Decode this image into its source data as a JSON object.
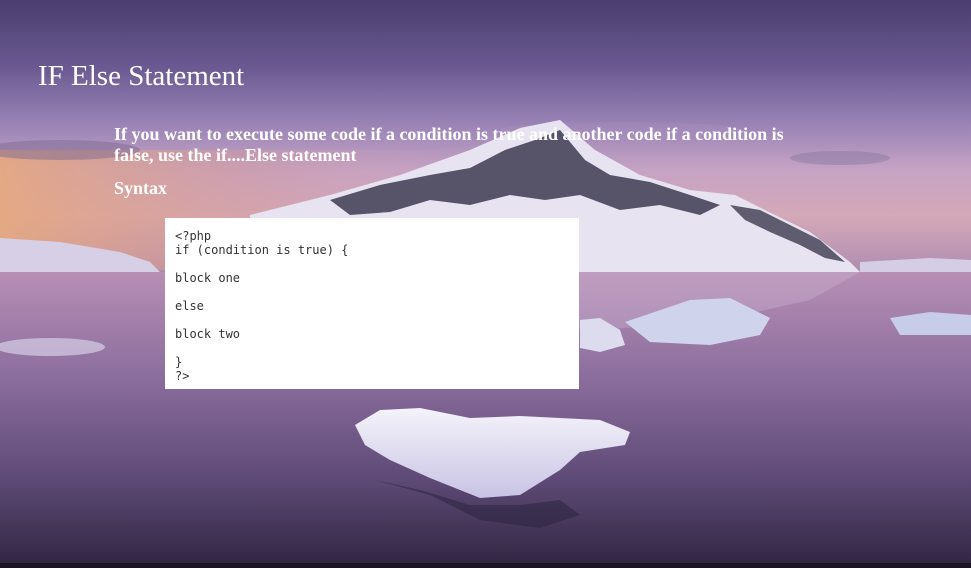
{
  "slide": {
    "title": "IF Else Statement",
    "intro": "If you want to execute some code if a condition is true and another code if a condition is false, use the if....Else statement",
    "syntax_label": "Syntax",
    "code_lines": [
      "<?php",
      "if (condition is true) {",
      "",
      "block one",
      "",
      "else",
      "",
      "block two",
      "",
      "}",
      "?>"
    ]
  }
}
